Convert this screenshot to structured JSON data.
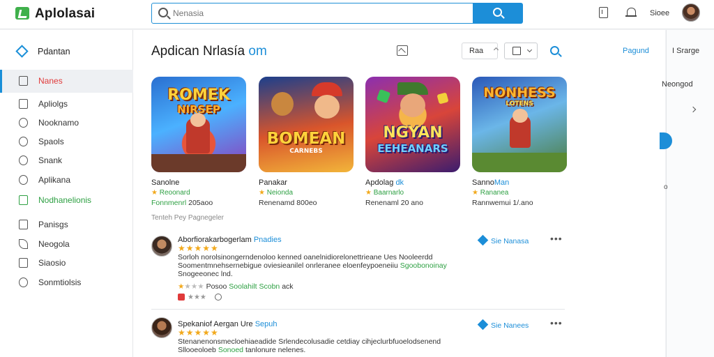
{
  "header": {
    "logo_text": "Aplolasai",
    "search_placeholder": "Nenasia",
    "sign_in": "Sioee"
  },
  "sidebar": {
    "head_label": "Pdantan",
    "items": [
      {
        "label": "Nanes",
        "icon": "list-icon",
        "active": true
      },
      {
        "label": "Apliolgs",
        "icon": "share-icon"
      },
      {
        "label": "Nooknamo",
        "icon": "bell-icon"
      },
      {
        "label": "Spaols",
        "icon": "chat-icon"
      },
      {
        "label": "Snank",
        "icon": "search-icon"
      },
      {
        "label": "Aplikana",
        "icon": "search-icon"
      },
      {
        "label": "Nodhanelionis",
        "icon": "square-icon",
        "green": true
      },
      {
        "label": "Panisgs",
        "icon": "columns-icon"
      },
      {
        "label": "Neogola",
        "icon": "leaf-icon"
      },
      {
        "label": "Siaosio",
        "icon": "square-icon"
      },
      {
        "label": "Sonmtiolsis",
        "icon": "chat-icon"
      }
    ]
  },
  "main": {
    "title": "Apdican Nrlasía",
    "title_accent": "om",
    "sort_label": "Raa",
    "featured_link": "Pagund",
    "section_caption": "Tenteh Pey Pagnegeler",
    "cards": [
      {
        "art_line1": "ROMEK",
        "art_line2": "NIRSEP",
        "name": "Sanolne",
        "name_accent": "",
        "rating": "Reoonard",
        "price": "Fonnmenrl",
        "price_num": "205aoo",
        "price_green": true
      },
      {
        "art_line1": "BOMEAN",
        "art_line2": "CARNEBS",
        "name": "Panakar",
        "name_accent": "",
        "rating": "Neionda",
        "price": "Renenamd",
        "price_num": "800eo",
        "price_green": false
      },
      {
        "art_line1": "NGYAN",
        "art_line2": "EEHEANARS",
        "name": "Apdolag",
        "name_accent": "dk",
        "rating": "Baarnarlo",
        "price": "Renenaml",
        "price_num": "20 ano",
        "price_green": false
      },
      {
        "art_line1": "NONHESS",
        "art_line2": "LOTENS",
        "name": "Sanno",
        "name_accent": "Man",
        "rating": "Rananea",
        "price": "Rannwemui",
        "price_num": "1/.ano",
        "price_green": false
      }
    ],
    "reviews": [
      {
        "name": "Aborfiorakarbogerlam",
        "name_accent": "Pnadies",
        "badge": "Sie Nanasa",
        "text": "Sorloh norolsinongerndenoloo kenned oanelnidiorelonettrieane Ues Nooleerdd Soomentmnehsernebigue oviesieanilel onrleranee eloenfeypoeneiiu",
        "text_green": "Sgoobonoinay",
        "text_tail": "Snogeeonec lnd.",
        "sub_prefix": "Posoo",
        "sub_green": "Soolahilt Scobn",
        "sub_suffix": "ack"
      },
      {
        "name": "Spekaniof Aergan Ure",
        "name_accent": "Sepuh",
        "badge": "Sie Nanees",
        "text": "Stenanenonsmecloehiaeadide Srlendecolusadie cetdiay cihjeclurbfuoelodsenend Sllooeoloeb",
        "text_green": "Sonoed",
        "text_tail": "tanlonure nelenes."
      }
    ]
  },
  "right_panel": {
    "search_label": "I Srarge",
    "link_label": "Neongod",
    "small_label": "o"
  },
  "colors": {
    "accent": "#1c8ed8",
    "green": "#2ea043",
    "active_red": "#e03a3a",
    "star": "#f2a91c"
  }
}
